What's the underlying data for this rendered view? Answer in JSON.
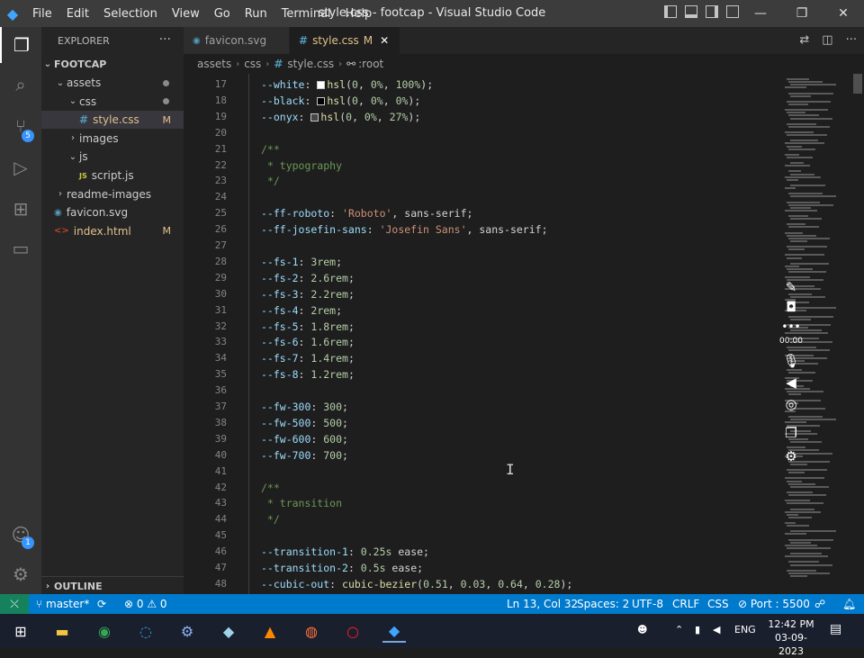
{
  "window": {
    "title": "style.css - footcap - Visual Studio Code",
    "menu": [
      "File",
      "Edit",
      "Selection",
      "View",
      "Go",
      "Run",
      "Terminal",
      "Help"
    ]
  },
  "activity": {
    "scm_badge": "5",
    "accounts_badge": "1"
  },
  "explorer": {
    "header": "EXPLORER",
    "more": "···",
    "root": "FOOTCAP",
    "items": [
      {
        "label": "assets",
        "decoration": "dot"
      },
      {
        "label": "css",
        "decoration": "dot"
      },
      {
        "label": "style.css",
        "decoration": "M",
        "icon": "#"
      },
      {
        "label": "images",
        "decoration": ""
      },
      {
        "label": "js",
        "decoration": ""
      },
      {
        "label": "script.js",
        "decoration": "",
        "icon": "JS"
      },
      {
        "label": "readme-images",
        "decoration": ""
      },
      {
        "label": "favicon.svg",
        "decoration": ""
      },
      {
        "label": "index.html",
        "decoration": "M"
      }
    ],
    "outline": "OUTLINE"
  },
  "tabs": [
    {
      "label": "favicon.svg",
      "active": false
    },
    {
      "label": "style.css",
      "modified": "M",
      "active": true
    }
  ],
  "breadcrumb": [
    "assets",
    "css",
    "style.css",
    ":root"
  ],
  "code_lines": [
    {
      "n": "17",
      "tokens": [
        [
          "prop",
          "--white"
        ],
        [
          "p",
          ": "
        ],
        [
          "sw",
          "#ffffff"
        ],
        [
          "fn",
          "hsl"
        ],
        [
          "p",
          "("
        ],
        [
          "num",
          "0"
        ],
        [
          "p",
          ", "
        ],
        [
          "num",
          "0%"
        ],
        [
          "p",
          ", "
        ],
        [
          "num",
          "100%"
        ],
        [
          "p",
          ");"
        ]
      ]
    },
    {
      "n": "18",
      "tokens": [
        [
          "prop",
          "--black"
        ],
        [
          "p",
          ": "
        ],
        [
          "sw",
          "#000000"
        ],
        [
          "fn",
          "hsl"
        ],
        [
          "p",
          "("
        ],
        [
          "num",
          "0"
        ],
        [
          "p",
          ", "
        ],
        [
          "num",
          "0%"
        ],
        [
          "p",
          ", "
        ],
        [
          "num",
          "0%"
        ],
        [
          "p",
          ");"
        ]
      ]
    },
    {
      "n": "19",
      "tokens": [
        [
          "prop",
          "--onyx"
        ],
        [
          "p",
          ": "
        ],
        [
          "sw",
          "#454545"
        ],
        [
          "fn",
          "hsl"
        ],
        [
          "p",
          "("
        ],
        [
          "num",
          "0"
        ],
        [
          "p",
          ", "
        ],
        [
          "num",
          "0%"
        ],
        [
          "p",
          ", "
        ],
        [
          "num",
          "27%"
        ],
        [
          "p",
          ");"
        ]
      ]
    },
    {
      "n": "20",
      "tokens": []
    },
    {
      "n": "21",
      "tokens": [
        [
          "cmt",
          "/**"
        ]
      ]
    },
    {
      "n": "22",
      "tokens": [
        [
          "cmt",
          " * typography"
        ]
      ]
    },
    {
      "n": "23",
      "tokens": [
        [
          "cmt",
          " */"
        ]
      ]
    },
    {
      "n": "24",
      "tokens": []
    },
    {
      "n": "25",
      "tokens": [
        [
          "prop",
          "--ff-roboto"
        ],
        [
          "p",
          ": "
        ],
        [
          "str",
          "'Roboto'"
        ],
        [
          "p",
          ", sans-serif;"
        ]
      ]
    },
    {
      "n": "26",
      "tokens": [
        [
          "prop",
          "--ff-josefin-sans"
        ],
        [
          "p",
          ": "
        ],
        [
          "str",
          "'Josefin Sans'"
        ],
        [
          "p",
          ", sans-serif;"
        ]
      ]
    },
    {
      "n": "27",
      "tokens": []
    },
    {
      "n": "28",
      "tokens": [
        [
          "prop",
          "--fs-1"
        ],
        [
          "p",
          ": "
        ],
        [
          "num",
          "3rem"
        ],
        [
          "p",
          ";"
        ]
      ]
    },
    {
      "n": "29",
      "tokens": [
        [
          "prop",
          "--fs-2"
        ],
        [
          "p",
          ": "
        ],
        [
          "num",
          "2.6rem"
        ],
        [
          "p",
          ";"
        ]
      ]
    },
    {
      "n": "30",
      "tokens": [
        [
          "prop",
          "--fs-3"
        ],
        [
          "p",
          ": "
        ],
        [
          "num",
          "2.2rem"
        ],
        [
          "p",
          ";"
        ]
      ]
    },
    {
      "n": "31",
      "tokens": [
        [
          "prop",
          "--fs-4"
        ],
        [
          "p",
          ": "
        ],
        [
          "num",
          "2rem"
        ],
        [
          "p",
          ";"
        ]
      ]
    },
    {
      "n": "32",
      "tokens": [
        [
          "prop",
          "--fs-5"
        ],
        [
          "p",
          ": "
        ],
        [
          "num",
          "1.8rem"
        ],
        [
          "p",
          ";"
        ]
      ]
    },
    {
      "n": "33",
      "tokens": [
        [
          "prop",
          "--fs-6"
        ],
        [
          "p",
          ": "
        ],
        [
          "num",
          "1.6rem"
        ],
        [
          "p",
          ";"
        ]
      ]
    },
    {
      "n": "34",
      "tokens": [
        [
          "prop",
          "--fs-7"
        ],
        [
          "p",
          ": "
        ],
        [
          "num",
          "1.4rem"
        ],
        [
          "p",
          ";"
        ]
      ]
    },
    {
      "n": "35",
      "tokens": [
        [
          "prop",
          "--fs-8"
        ],
        [
          "p",
          ": "
        ],
        [
          "num",
          "1.2rem"
        ],
        [
          "p",
          ";"
        ]
      ]
    },
    {
      "n": "36",
      "tokens": []
    },
    {
      "n": "37",
      "tokens": [
        [
          "prop",
          "--fw-300"
        ],
        [
          "p",
          ": "
        ],
        [
          "num",
          "300"
        ],
        [
          "p",
          ";"
        ]
      ]
    },
    {
      "n": "38",
      "tokens": [
        [
          "prop",
          "--fw-500"
        ],
        [
          "p",
          ": "
        ],
        [
          "num",
          "500"
        ],
        [
          "p",
          ";"
        ]
      ]
    },
    {
      "n": "39",
      "tokens": [
        [
          "prop",
          "--fw-600"
        ],
        [
          "p",
          ": "
        ],
        [
          "num",
          "600"
        ],
        [
          "p",
          ";"
        ]
      ]
    },
    {
      "n": "40",
      "tokens": [
        [
          "prop",
          "--fw-700"
        ],
        [
          "p",
          ": "
        ],
        [
          "num",
          "700"
        ],
        [
          "p",
          ";"
        ]
      ]
    },
    {
      "n": "41",
      "tokens": []
    },
    {
      "n": "42",
      "tokens": [
        [
          "cmt",
          "/**"
        ]
      ]
    },
    {
      "n": "43",
      "tokens": [
        [
          "cmt",
          " * transition"
        ]
      ]
    },
    {
      "n": "44",
      "tokens": [
        [
          "cmt",
          " */"
        ]
      ]
    },
    {
      "n": "45",
      "tokens": []
    },
    {
      "n": "46",
      "tokens": [
        [
          "prop",
          "--transition-1"
        ],
        [
          "p",
          ": "
        ],
        [
          "num",
          "0.25s"
        ],
        [
          "p",
          " ease;"
        ]
      ]
    },
    {
      "n": "47",
      "tokens": [
        [
          "prop",
          "--transition-2"
        ],
        [
          "p",
          ": "
        ],
        [
          "num",
          "0.5s"
        ],
        [
          "p",
          " ease;"
        ]
      ]
    },
    {
      "n": "48",
      "tokens": [
        [
          "prop",
          "--cubic-out"
        ],
        [
          "p",
          ": "
        ],
        [
          "fn",
          "cubic-bezier"
        ],
        [
          "p",
          "("
        ],
        [
          "num",
          "0.51"
        ],
        [
          "p",
          ", "
        ],
        [
          "num",
          "0.03"
        ],
        [
          "p",
          ", "
        ],
        [
          "num",
          "0.64"
        ],
        [
          "p",
          ", "
        ],
        [
          "num",
          "0.28"
        ],
        [
          "p",
          ");"
        ]
      ]
    }
  ],
  "overlay": {
    "time": "00:00"
  },
  "status": {
    "branch": "master*",
    "errors": "0",
    "warnings": "0",
    "position": "Ln 13, Col 32",
    "spaces": "Spaces: 2",
    "encoding": "UTF-8",
    "eol": "CRLF",
    "language": "CSS",
    "port": "Port : 5500"
  },
  "taskbar": {
    "lang": "ENG",
    "time": "12:42 PM",
    "date": "03-09-2023"
  }
}
